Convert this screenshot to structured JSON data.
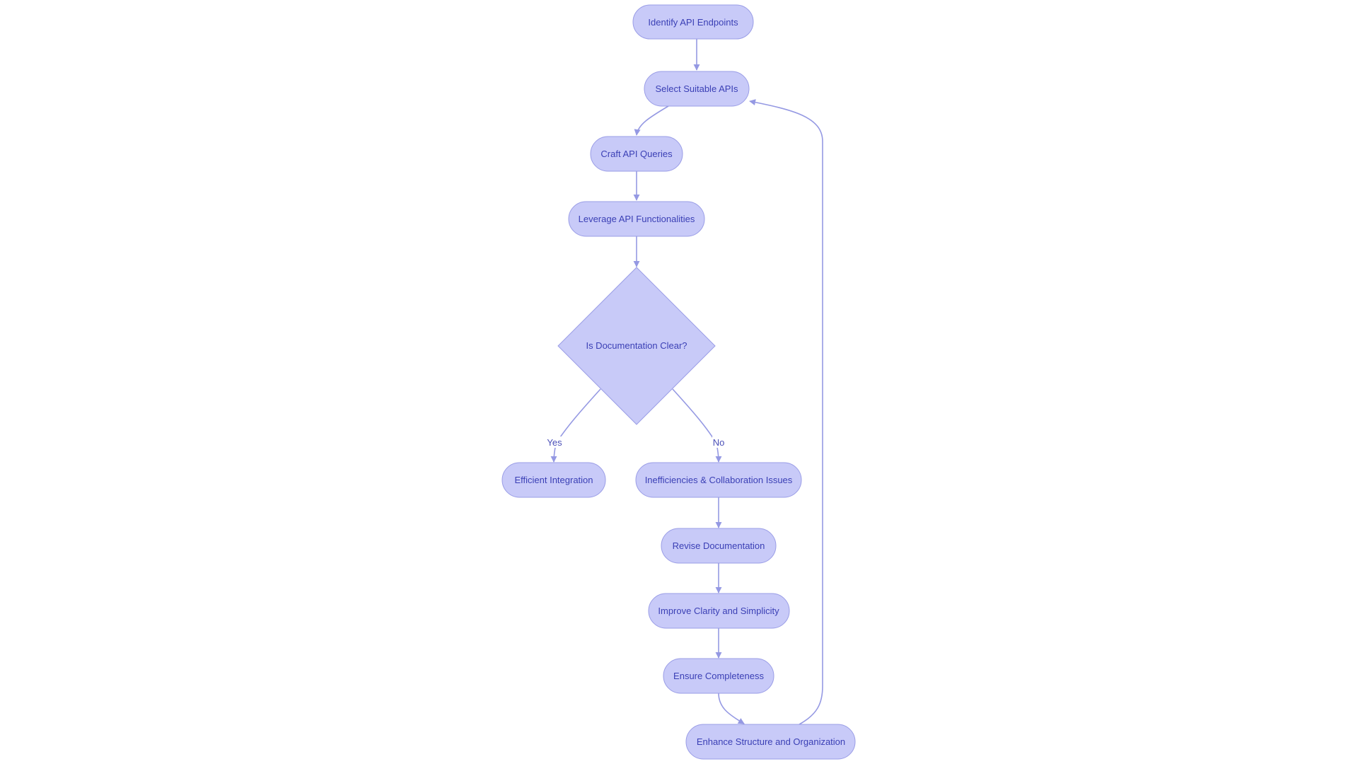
{
  "diagram": {
    "type": "flowchart",
    "direction": "top-down",
    "colors": {
      "node_fill": "#c8caf8",
      "node_stroke": "#9a9de6",
      "node_text": "#3a3fb5",
      "edge": "#9599e3",
      "background": "#ffffff"
    },
    "nodes": [
      {
        "id": "identify",
        "label": "Identify API Endpoints",
        "shape": "stadium"
      },
      {
        "id": "select",
        "label": "Select Suitable APIs",
        "shape": "stadium"
      },
      {
        "id": "craft",
        "label": "Craft API Queries",
        "shape": "stadium"
      },
      {
        "id": "leverage",
        "label": "Leverage API Functionalities",
        "shape": "stadium"
      },
      {
        "id": "decision",
        "label": "Is Documentation Clear?",
        "shape": "diamond"
      },
      {
        "id": "efficient",
        "label": "Efficient Integration",
        "shape": "stadium"
      },
      {
        "id": "inefficiencies",
        "label": "Inefficiencies & Collaboration Issues",
        "shape": "stadium"
      },
      {
        "id": "revise",
        "label": "Revise Documentation",
        "shape": "stadium"
      },
      {
        "id": "improve",
        "label": "Improve Clarity and Simplicity",
        "shape": "stadium"
      },
      {
        "id": "ensure",
        "label": "Ensure Completeness",
        "shape": "stadium"
      },
      {
        "id": "enhance",
        "label": "Enhance Structure and Organization",
        "shape": "stadium"
      }
    ],
    "edges": [
      {
        "from": "identify",
        "to": "select",
        "label": ""
      },
      {
        "from": "select",
        "to": "craft",
        "label": ""
      },
      {
        "from": "craft",
        "to": "leverage",
        "label": ""
      },
      {
        "from": "leverage",
        "to": "decision",
        "label": ""
      },
      {
        "from": "decision",
        "to": "efficient",
        "label": "Yes"
      },
      {
        "from": "decision",
        "to": "inefficiencies",
        "label": "No"
      },
      {
        "from": "inefficiencies",
        "to": "revise",
        "label": ""
      },
      {
        "from": "revise",
        "to": "improve",
        "label": ""
      },
      {
        "from": "improve",
        "to": "ensure",
        "label": ""
      },
      {
        "from": "ensure",
        "to": "enhance",
        "label": ""
      },
      {
        "from": "enhance",
        "to": "select",
        "label": ""
      }
    ]
  }
}
